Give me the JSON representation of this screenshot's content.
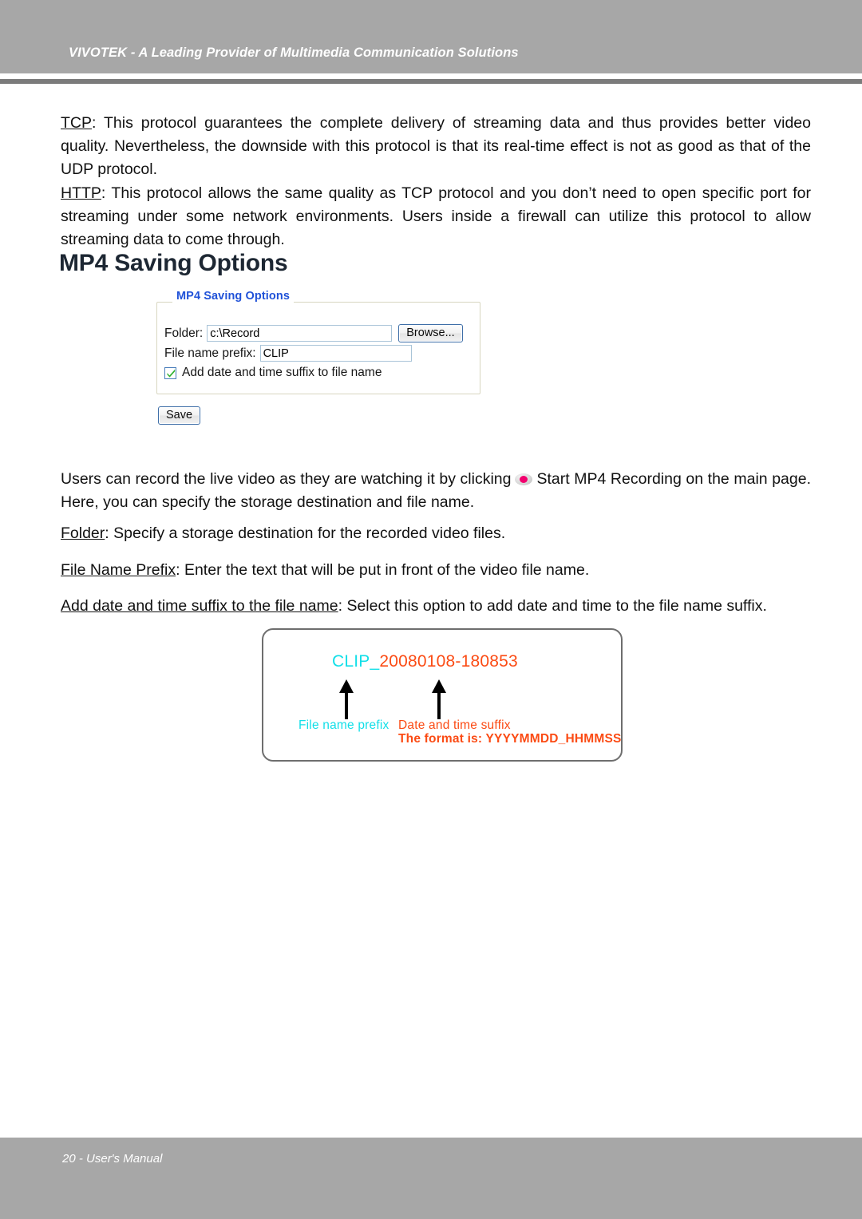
{
  "header": {
    "title": "VIVOTEK - A Leading Provider of Multimedia Communication Solutions"
  },
  "body": {
    "paragraph_tcp": {
      "term": "TCP",
      "text": ": This protocol guarantees the complete delivery of streaming data and thus provides better video quality. Nevertheless, the downside with this protocol is that its real-time effect is not as good as that of the UDP protocol."
    },
    "paragraph_http": {
      "term": "HTTP",
      "text": ": This protocol allows the same quality as TCP protocol and you don’t need to open specific port for streaming under some network environments. Users inside a firewall can utilize this protocol to allow streaming data to come through."
    },
    "section_heading": "MP4 Saving Options",
    "paragraph_record": {
      "text_before": "Users can record the live video as they are watching it by clicking",
      "icon": "record-icon",
      "text_after": "Start MP4 Recording on the main page. Here, you can specify the storage destination and file name."
    },
    "definitions": [
      {
        "term": "Folder",
        "text": ": Specify a storage destination for the recorded video files."
      },
      {
        "term": "File Name Prefix",
        "text": ": Enter the text that will be put in front of the video file name."
      },
      {
        "term": "Add date and time suffix to the file name",
        "text": ": Select this option to add date and time to the file name suffix."
      }
    ]
  },
  "mp4_panel": {
    "legend": "MP4 Saving Options",
    "folder_label": "Folder:",
    "folder_value": "c:\\Record",
    "folder_placeholder": "",
    "browse_label": "Browse...",
    "prefix_label": "File name prefix:",
    "prefix_value": "CLIP",
    "prefix_placeholder": "",
    "suffix_checkbox_label": "Add date and time suffix to file name",
    "suffix_checkbox_checked": true,
    "save_label": "Save"
  },
  "illustration": {
    "filename_prefix": "CLIP_",
    "filename_suffix": "20080108-180853",
    "annotation_prefix": "File name prefix",
    "annotation_suffix": "Date and time suffix",
    "annotation_format": "The format is: YYYYMMDD_HHMMSS"
  },
  "footer": {
    "text": "20 - User's Manual"
  },
  "colors": {
    "band_gray": "#a7a7a7",
    "rule_gray": "#7b7b7b",
    "legend_blue": "#2052d8",
    "heading_navy": "#1d2733",
    "cyan": "#12dfe8",
    "orange": "#fb4b14",
    "record_dot": "#f2006e",
    "check_green": "#2fb12f"
  }
}
